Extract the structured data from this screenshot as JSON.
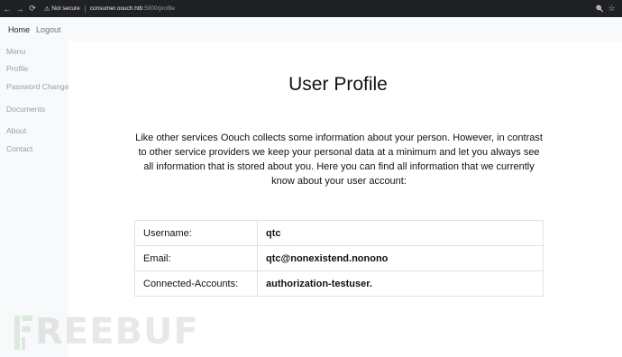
{
  "browser": {
    "back_icon": "←",
    "forward_icon": "→",
    "reload_icon": "⟳",
    "warning_icon": "⚠",
    "not_secure": "Not secure",
    "url_host": "consumer.oouch.htb",
    "url_rest": ":5000/profile",
    "zoom_icon": "🔍",
    "star_icon": "☆"
  },
  "navbar": {
    "home": "Home",
    "logout": "Logout"
  },
  "sidebar": {
    "items": [
      {
        "label": "Menu"
      },
      {
        "label": "Profile"
      },
      {
        "label": "Password Change"
      },
      {
        "label": "Documents"
      },
      {
        "label": "About"
      },
      {
        "label": "Contact"
      }
    ]
  },
  "main": {
    "title": "User Profile",
    "intro": "Like other services Oouch collects some information about your person. However, in contrast to other service providers we keep your personal data at a minimum and let you always see all information that is stored about you. Here you can find all information that we currently know about your user account:",
    "rows": [
      {
        "label": "Username:",
        "value": "qtc"
      },
      {
        "label": "Email:",
        "value": "qtc@nonexistend.nonono"
      },
      {
        "label": "Connected-Accounts:",
        "value": "authorization-testuser."
      }
    ]
  },
  "watermark": {
    "text": "REEBUF"
  },
  "colors": {
    "sidebar_bg": "#f8f9fa",
    "chrome_bg": "#202124",
    "table_border": "#dee2e6"
  }
}
